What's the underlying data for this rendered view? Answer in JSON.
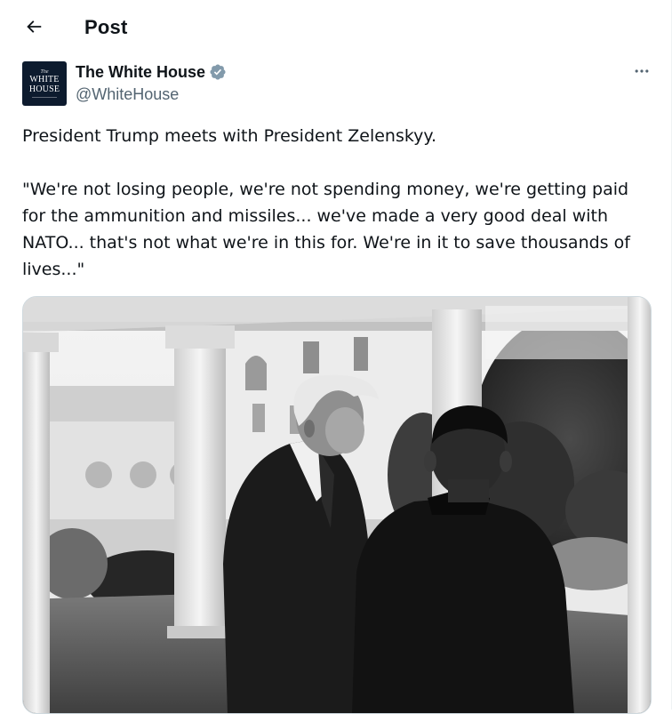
{
  "header": {
    "back_icon": "back-arrow-icon",
    "title": "Post"
  },
  "author": {
    "avatar_text_small": "The",
    "avatar_text_line1": "WHITE",
    "avatar_text_line2": "HOUSE",
    "display_name": "The White House",
    "verified_icon": "verified-badge-icon",
    "handle": "@WhiteHouse",
    "more_icon": "more-options-icon"
  },
  "tweet": {
    "line1": "President Trump meets with President Zelenskyy.",
    "quote": "\"We're not losing people, we're not spending money, we're getting paid for the ammunition and missiles... we've made a very good deal with NATO... that's not what we're in this for. We're in it to save thousands of lives...\""
  },
  "media": {
    "photo_icon": "black-and-white-photo",
    "style": "black-and-white"
  },
  "colors": {
    "text_primary": "#0f1419",
    "text_secondary": "#536471",
    "verified_badge": "#829aab",
    "border": "#cfd9de"
  }
}
